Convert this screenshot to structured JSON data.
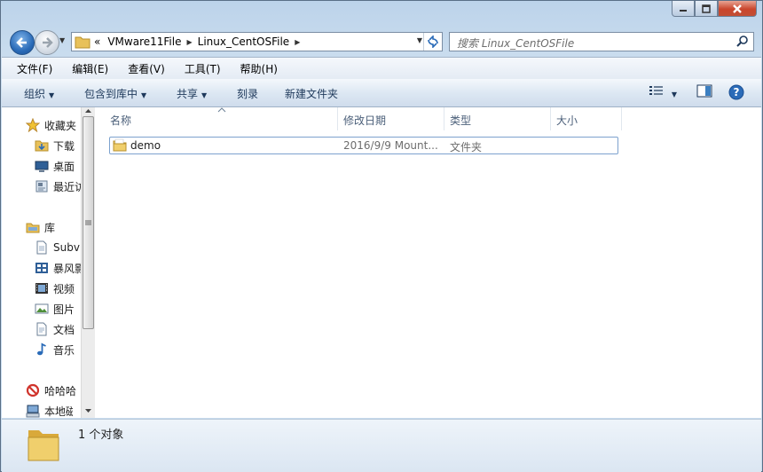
{
  "window": {
    "controls": [
      "minimize",
      "maximize",
      "close"
    ]
  },
  "address": {
    "overflow": "«",
    "crumbs": [
      "VMware11File",
      "Linux_CentOSFile"
    ]
  },
  "search": {
    "placeholder": "搜索 Linux_CentOSFile"
  },
  "menubar": [
    "文件(F)",
    "编辑(E)",
    "查看(V)",
    "工具(T)",
    "帮助(H)"
  ],
  "commands": {
    "organize": "组织",
    "include_library": "包含到库中",
    "share": "共享",
    "burn": "刻录",
    "new_folder": "新建文件夹"
  },
  "navpane": {
    "favorites_header": "收藏夹",
    "favorites": [
      "下载",
      "桌面",
      "最近访"
    ],
    "libraries_header": "库",
    "libraries": [
      "Subv",
      "暴风影",
      "视频",
      "图片",
      "文档",
      "音乐"
    ],
    "homegroup": "哈哈哈",
    "computer": "本地磁"
  },
  "columns": {
    "name": "名称",
    "date": "修改日期",
    "type": "类型",
    "size": "大小"
  },
  "files": [
    {
      "name": "demo",
      "date": "2016/9/9 Mount...",
      "type": "文件夹",
      "size": ""
    }
  ],
  "status": {
    "text": "1 个对象"
  },
  "colors": {
    "accent": "#2a6bb8",
    "folder": "#e8c15a",
    "link": "#1e395b"
  }
}
